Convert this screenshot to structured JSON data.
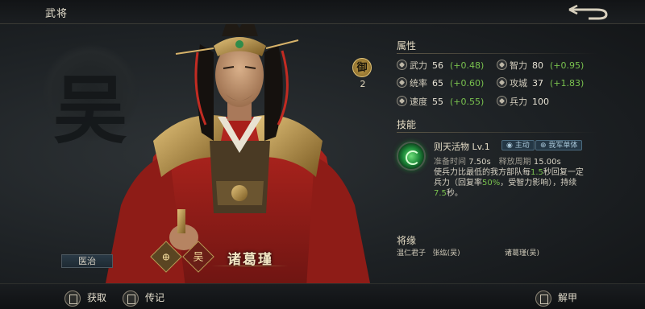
{
  "header": {
    "title": "武将"
  },
  "hero": {
    "name": "诸葛瑾",
    "faction_emblem": "吴",
    "rank_seal": "御",
    "rank_level": "2",
    "background_glyph": "吴",
    "role_label": "医治",
    "emblem_left_icon": "target-icon",
    "emblem_right_icon": "faction-wu-icon"
  },
  "attributes": {
    "title": "属性",
    "stats": [
      {
        "icon": "sword-icon",
        "label": "武力",
        "value": "56",
        "growth": "(+0.48)"
      },
      {
        "icon": "brain-icon",
        "label": "智力",
        "value": "80",
        "growth": "(+0.95)"
      },
      {
        "icon": "horse-icon",
        "label": "统率",
        "value": "65",
        "growth": "(+0.60)"
      },
      {
        "icon": "siege-icon",
        "label": "攻城",
        "value": "37",
        "growth": "(+1.83)"
      },
      {
        "icon": "boot-icon",
        "label": "速度",
        "value": "55",
        "growth": "(+0.55)"
      },
      {
        "icon": "soldier-icon",
        "label": "兵力",
        "value": "100",
        "growth": ""
      }
    ]
  },
  "skill": {
    "section_title": "技能",
    "name": "则天活物",
    "level": "Lv.1",
    "tag_type": "主动",
    "tag_target": "我军单体",
    "prep_label": "准备时间",
    "prep_value": "7.50s",
    "cycle_label": "释放周期",
    "cycle_value": "15.00s",
    "desc_1": "使兵力比最低的我方部队每",
    "desc_hl1": "1.5",
    "desc_2": "秒回复一定兵力（回复率",
    "desc_hl2": "50%",
    "desc_3": "，受智力影响），持续",
    "desc_hl3": "7.5",
    "desc_4": "秒。"
  },
  "fate": {
    "title": "将缘",
    "entries": [
      {
        "name": "温仁君子",
        "members": "张纮(吴)"
      },
      {
        "name": "",
        "members": "诸葛瑾(吴)"
      }
    ]
  },
  "bottom": {
    "obtain": "获取",
    "biography": "传记",
    "dismiss": "解甲"
  },
  "colors": {
    "growth": "#78c04e",
    "accent_gold": "#c6a24e"
  }
}
